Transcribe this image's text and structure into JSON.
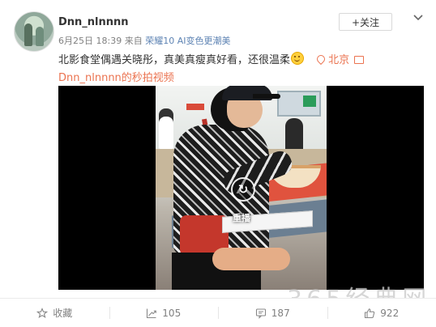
{
  "post": {
    "username": "Dnn_nlnnnn",
    "follow_label": "+关注",
    "meta": {
      "date": "6月25日 18:39",
      "source_prefix": "来自",
      "source": "荣耀10 AI变色更潮美"
    },
    "content_text": "北影食堂偶遇关晓彤，真美真瘦真好看，还很温柔",
    "emoji": "smiley-emoji",
    "location": "北京",
    "video_link": "Dnn_nlnnnn的秒拍视频"
  },
  "video": {
    "replay_label": "重播"
  },
  "watermark": "365经典网",
  "toolbar": {
    "favorite": {
      "label": "收藏",
      "icon": "star-icon"
    },
    "repost": {
      "count": "105",
      "icon": "repost-icon"
    },
    "comment": {
      "count": "187",
      "icon": "comment-icon"
    },
    "like": {
      "count": "922",
      "icon": "thumbs-up-icon"
    }
  },
  "colors": {
    "accent": "#eb7350",
    "link_blue": "#5d83b3",
    "text": "#333333",
    "muted": "#808080"
  }
}
